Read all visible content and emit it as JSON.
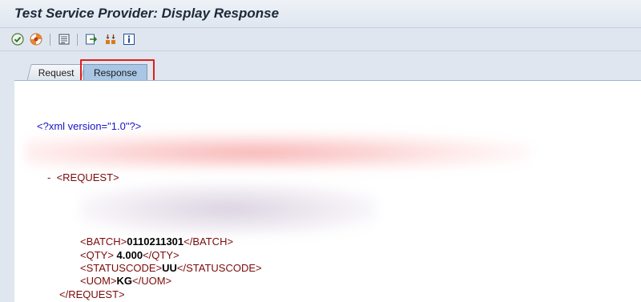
{
  "window": {
    "title": "Test Service Provider: Display Response"
  },
  "toolbar": {
    "buttons": [
      {
        "name": "check-icon"
      },
      {
        "name": "stop-icon"
      },
      {
        "name": "list-icon"
      },
      {
        "name": "export-icon"
      },
      {
        "name": "details-icon"
      },
      {
        "name": "info-icon"
      }
    ]
  },
  "tabs": [
    {
      "label": "Request",
      "active": false
    },
    {
      "label": "Response",
      "active": true
    }
  ],
  "xml": {
    "declaration": "<?xml version=\"1.0\"?>",
    "collapse_marker": "-",
    "request_open": "<REQUEST>",
    "request_close": "</REQUEST>",
    "fields": [
      {
        "open": "<BATCH>",
        "value": "0110211301",
        "close": "</BATCH>"
      },
      {
        "open": "<QTY>",
        "value": " 4.000",
        "close": "</QTY>"
      },
      {
        "open": "<STATUSCODE>",
        "value": "UU",
        "close": "</STATUSCODE>"
      },
      {
        "open": "<UOM>",
        "value": "KG",
        "close": "</UOM>"
      }
    ]
  },
  "colors": {
    "tag": "#7b0a0a",
    "declaration": "#1515c8",
    "active_tab": "#a9c6e4",
    "highlight": "#e01d1d"
  }
}
